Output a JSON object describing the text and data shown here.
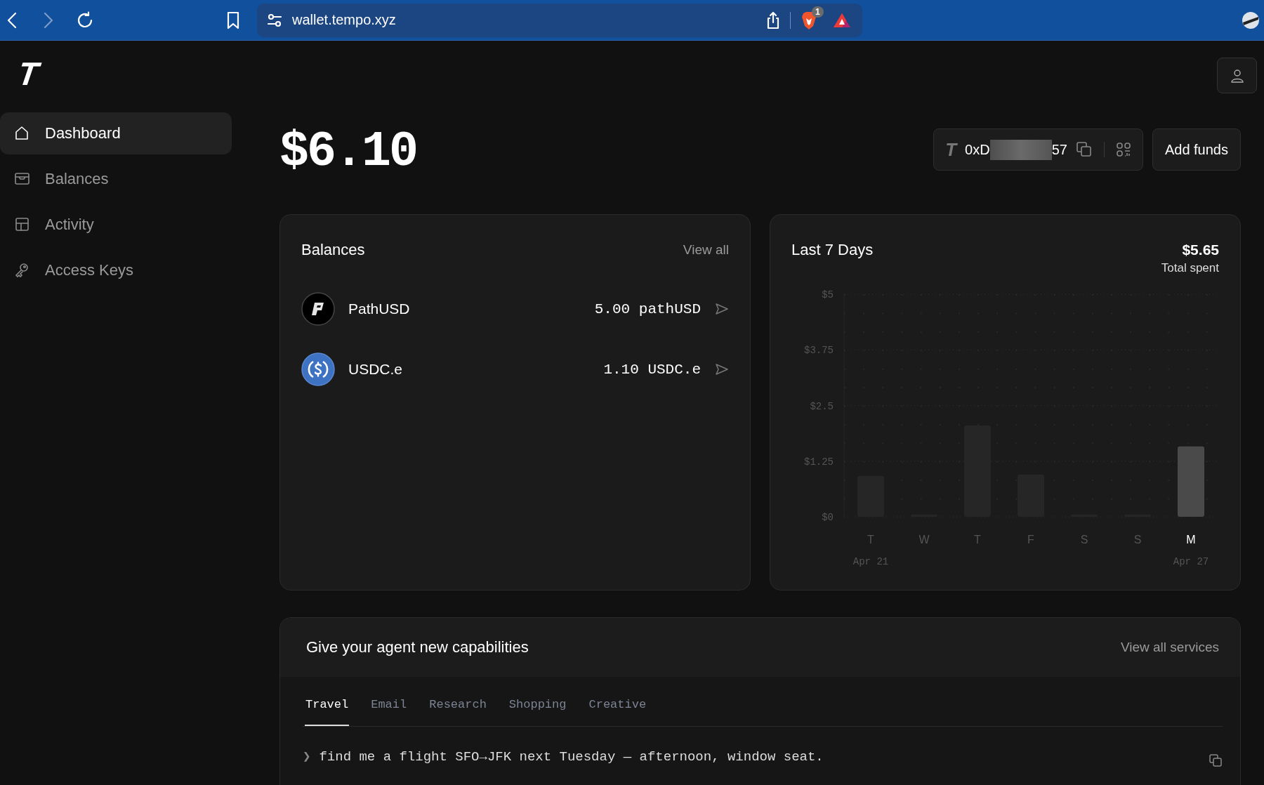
{
  "browser": {
    "url": "wallet.tempo.xyz",
    "extension_badge": "1"
  },
  "logo": "T",
  "sidebar": {
    "items": [
      {
        "label": "Dashboard",
        "kind": "home",
        "selected": true
      },
      {
        "label": "Balances",
        "kind": "wallet",
        "selected": false
      },
      {
        "label": "Activity",
        "kind": "table",
        "selected": false
      },
      {
        "label": "Access Keys",
        "kind": "key",
        "selected": false
      }
    ]
  },
  "total_balance": "$6.10",
  "address": {
    "logo": "T",
    "start": "0xD",
    "end": "57"
  },
  "add_funds_button": "Add funds",
  "balances": {
    "title": "Balances",
    "view_all": "View all",
    "tokens": [
      {
        "name": "PathUSD",
        "amount": "5.00 pathUSD",
        "kind": "path"
      },
      {
        "name": "USDC.e",
        "amount": "1.10 USDC.e",
        "kind": "usdc"
      }
    ]
  },
  "last_7_days": {
    "title": "Last 7 Days",
    "total": "$5.65",
    "total_label": "Total spent",
    "days": [
      {
        "selected": false
      },
      {
        "selected": false
      },
      {
        "selected": false
      },
      {
        "selected": false
      },
      {
        "selected": false
      },
      {
        "selected": false
      },
      {
        "selected": true
      }
    ],
    "date_labels": [
      "Apr 21",
      "Apr 27"
    ],
    "chart_data": {
      "type": "bar",
      "categories": [
        "T",
        "W",
        "T",
        "F",
        "S",
        "S",
        "M"
      ],
      "values": [
        0.92,
        0.05,
        2.05,
        0.95,
        0.05,
        0.05,
        1.58
      ],
      "ylim": [
        0,
        5
      ],
      "grid": true,
      "yticks": [
        {
          "value": 0,
          "label": "$0"
        },
        {
          "value": 1.25,
          "label": "$1.25"
        },
        {
          "value": 2.5,
          "label": "$2.5"
        },
        {
          "value": 3.75,
          "label": "$3.75"
        },
        {
          "value": 5,
          "label": "$5"
        }
      ]
    }
  },
  "capabilities": {
    "title": "Give your agent new capabilities",
    "view_all": "View all services",
    "tabs": [
      {
        "label": "Travel",
        "selected": true
      },
      {
        "label": "Email",
        "selected": false
      },
      {
        "label": "Research",
        "selected": false
      },
      {
        "label": "Shopping",
        "selected": false
      },
      {
        "label": "Creative",
        "selected": false
      }
    ],
    "prompt_marker": "❯",
    "prompt": "find me a flight SFO→JFK next Tuesday — afternoon, window seat."
  }
}
